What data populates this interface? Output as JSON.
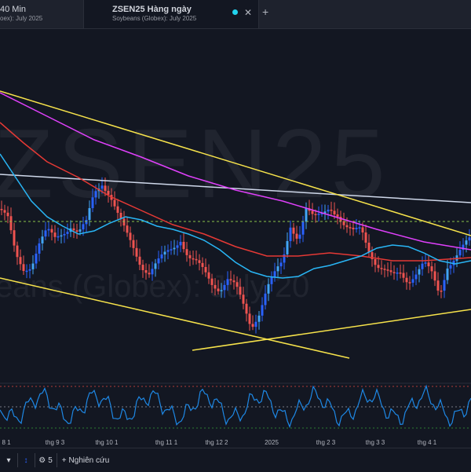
{
  "tabs": [
    {
      "title": "40 Min",
      "subtitle": "oex): July 2025"
    },
    {
      "title": "ZSEN25 Hàng ngày",
      "subtitle": "Soybeans (Globex): July 2025"
    }
  ],
  "watermark": {
    "symbol": "ZSEN25",
    "description": "eans (Globex): July 20"
  },
  "x_axis_labels": [
    "8 1",
    "thg 9 3",
    "thg 10 1",
    "thg 11 1",
    "thg 12 2",
    "2025",
    "thg 2 3",
    "thg 3 3",
    "thg 4 1"
  ],
  "colors": {
    "background": "#131722",
    "candle_up": "#2962ff",
    "candle_up_light": "#42a5f5",
    "candle_down": "#ef5350",
    "trendline": "#f7e34b",
    "ma_red": "#e53935",
    "ma_magenta": "#e040fb",
    "ma_blue": "#29b6f6",
    "horizontal_line": "#cfd8ea",
    "level_line": "#8bc34a",
    "oscillator": "#1e88e5"
  },
  "icons": [
    "close-icon",
    "plus-icon",
    "chevron-down-icon",
    "arrows-vertical-icon",
    "gear-icon",
    "plus-icon"
  ],
  "bottom_bar": {
    "indicator_count": "5",
    "research_label": "Nghiên cứu"
  }
}
